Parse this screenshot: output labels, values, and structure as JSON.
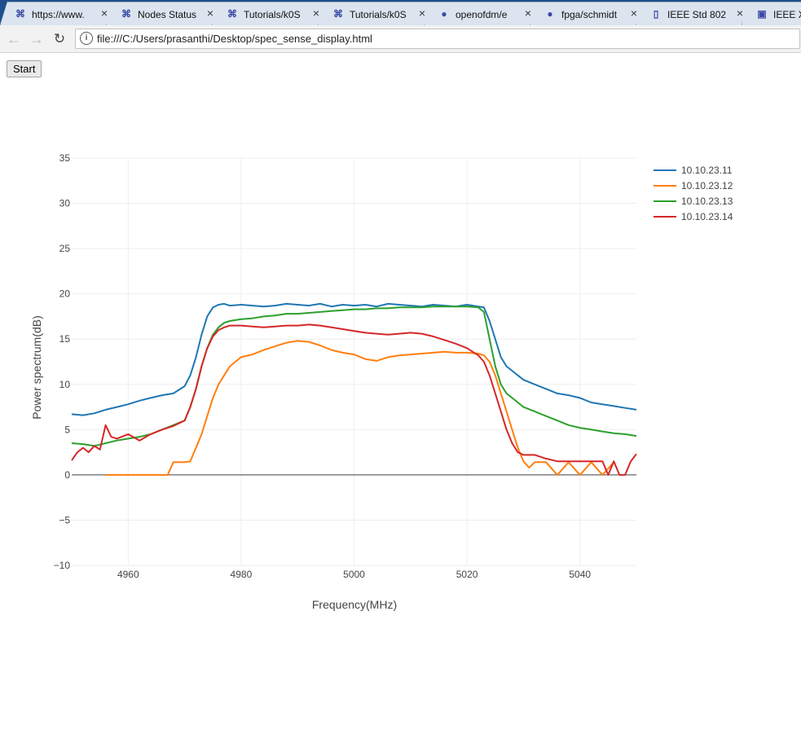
{
  "browser": {
    "tabs": [
      {
        "label": "https://www.",
        "icon": "orbit-icon"
      },
      {
        "label": "Nodes Status",
        "icon": "orbit-icon"
      },
      {
        "label": "Tutorials/k0S",
        "icon": "orbit-icon"
      },
      {
        "label": "Tutorials/k0S",
        "icon": "orbit-icon"
      },
      {
        "label": "openofdm/e",
        "icon": "github-icon"
      },
      {
        "label": "fpga/schmidt",
        "icon": "github-icon"
      },
      {
        "label": "IEEE Std 802",
        "icon": "document-icon"
      },
      {
        "label": "IEEE X",
        "icon": "ieee-icon"
      }
    ],
    "url": "file:///C:/Users/prasanthi/Desktop/spec_sense_display.html"
  },
  "page": {
    "start_label": "Start"
  },
  "chart_data": {
    "type": "line",
    "title": "",
    "xlabel": "Frequency(MHz)",
    "ylabel": "Power spectrum(dB)",
    "xlim": [
      4950,
      5050
    ],
    "ylim": [
      -10,
      35
    ],
    "xticks": [
      4960,
      4980,
      5000,
      5020,
      5040
    ],
    "yticks": [
      -10,
      -5,
      0,
      5,
      10,
      15,
      20,
      25,
      30,
      35
    ],
    "grid": true,
    "legend_position": "top-right, outside plot",
    "series": [
      {
        "name": "10.10.23.11",
        "color": "#1f77b4",
        "x": [
          4950,
          4952,
          4954,
          4956,
          4958,
          4960,
          4962,
          4964,
          4966,
          4968,
          4970,
          4971,
          4972,
          4973,
          4974,
          4975,
          4976,
          4977,
          4978,
          4980,
          4982,
          4984,
          4986,
          4988,
          4990,
          4992,
          4994,
          4996,
          4998,
          5000,
          5002,
          5004,
          5006,
          5008,
          5010,
          5012,
          5014,
          5016,
          5018,
          5020,
          5022,
          5023,
          5024,
          5025,
          5026,
          5027,
          5028,
          5029,
          5030,
          5032,
          5034,
          5036,
          5038,
          5040,
          5042,
          5044,
          5046,
          5048,
          5050
        ],
        "y": [
          6.7,
          6.6,
          6.8,
          7.2,
          7.5,
          7.8,
          8.2,
          8.5,
          8.8,
          9.0,
          9.8,
          11.0,
          13.0,
          15.5,
          17.5,
          18.5,
          18.8,
          18.9,
          18.7,
          18.8,
          18.7,
          18.6,
          18.7,
          18.9,
          18.8,
          18.7,
          18.9,
          18.6,
          18.8,
          18.7,
          18.8,
          18.6,
          18.9,
          18.8,
          18.7,
          18.6,
          18.8,
          18.7,
          18.6,
          18.8,
          18.6,
          18.5,
          17.0,
          15.0,
          13.0,
          12.0,
          11.5,
          11.0,
          10.5,
          10.0,
          9.5,
          9.0,
          8.8,
          8.5,
          8.0,
          7.8,
          7.6,
          7.4,
          7.2
        ]
      },
      {
        "name": "10.10.23.12",
        "color": "#ff7f0e",
        "x": [
          4956,
          4958,
          4960,
          4962,
          4964,
          4966,
          4967,
          4968,
          4969,
          4970,
          4971,
          4972,
          4973,
          4974,
          4975,
          4976,
          4977,
          4978,
          4980,
          4982,
          4984,
          4986,
          4988,
          4990,
          4992,
          4994,
          4996,
          4998,
          5000,
          5002,
          5004,
          5006,
          5008,
          5010,
          5012,
          5014,
          5016,
          5018,
          5020,
          5022,
          5023,
          5024,
          5025,
          5026,
          5027,
          5028,
          5029,
          5030,
          5031,
          5032,
          5034,
          5036,
          5038,
          5040,
          5042,
          5044,
          5046
        ],
        "y": [
          0.0,
          0.0,
          0.0,
          0.0,
          0.0,
          0.0,
          0.0,
          1.4,
          1.4,
          1.4,
          1.5,
          3.0,
          4.5,
          6.5,
          8.5,
          10.0,
          11.0,
          12.0,
          13.0,
          13.3,
          13.8,
          14.2,
          14.6,
          14.8,
          14.7,
          14.3,
          13.8,
          13.5,
          13.3,
          12.8,
          12.6,
          13.0,
          13.2,
          13.3,
          13.4,
          13.5,
          13.6,
          13.5,
          13.5,
          13.4,
          13.2,
          12.5,
          11.0,
          9.0,
          7.0,
          5.0,
          3.0,
          1.5,
          0.8,
          1.4,
          1.4,
          0.0,
          1.4,
          0.0,
          1.4,
          0.0,
          1.4
        ]
      },
      {
        "name": "10.10.23.13",
        "color": "#2ca02c",
        "x": [
          4950,
          4952,
          4954,
          4956,
          4958,
          4960,
          4962,
          4964,
          4966,
          4968,
          4970,
          4971,
          4972,
          4973,
          4974,
          4975,
          4976,
          4977,
          4978,
          4980,
          4982,
          4984,
          4986,
          4988,
          4990,
          4992,
          4994,
          4996,
          4998,
          5000,
          5002,
          5004,
          5006,
          5008,
          5010,
          5012,
          5014,
          5016,
          5018,
          5020,
          5022,
          5023,
          5024,
          5025,
          5026,
          5027,
          5028,
          5029,
          5030,
          5032,
          5034,
          5036,
          5038,
          5040,
          5042,
          5044,
          5046,
          5048,
          5050
        ],
        "y": [
          3.5,
          3.4,
          3.2,
          3.5,
          3.8,
          4.0,
          4.2,
          4.5,
          5.0,
          5.5,
          6.0,
          7.5,
          9.5,
          12.0,
          14.0,
          15.5,
          16.3,
          16.8,
          17.0,
          17.2,
          17.3,
          17.5,
          17.6,
          17.8,
          17.8,
          17.9,
          18.0,
          18.1,
          18.2,
          18.3,
          18.3,
          18.4,
          18.4,
          18.5,
          18.5,
          18.5,
          18.6,
          18.6,
          18.6,
          18.6,
          18.5,
          18.0,
          15.0,
          12.0,
          10.0,
          9.0,
          8.5,
          8.0,
          7.5,
          7.0,
          6.5,
          6.0,
          5.5,
          5.2,
          5.0,
          4.8,
          4.6,
          4.5,
          4.3
        ]
      },
      {
        "name": "10.10.23.14",
        "color": "#d62728",
        "x": [
          4950,
          4951,
          4952,
          4953,
          4954,
          4955,
          4956,
          4957,
          4958,
          4960,
          4962,
          4964,
          4966,
          4968,
          4970,
          4971,
          4972,
          4973,
          4974,
          4975,
          4976,
          4977,
          4978,
          4980,
          4982,
          4984,
          4986,
          4988,
          4990,
          4992,
          4994,
          4996,
          4998,
          5000,
          5002,
          5004,
          5006,
          5008,
          5010,
          5012,
          5014,
          5016,
          5018,
          5020,
          5022,
          5023,
          5024,
          5025,
          5026,
          5027,
          5028,
          5029,
          5030,
          5032,
          5034,
          5036,
          5038,
          5040,
          5042,
          5044,
          5045,
          5046,
          5047,
          5048,
          5049,
          5050
        ],
        "y": [
          1.6,
          2.5,
          3.0,
          2.5,
          3.2,
          2.8,
          5.5,
          4.2,
          4.0,
          4.5,
          3.8,
          4.5,
          5.0,
          5.4,
          6.0,
          7.5,
          9.5,
          12.0,
          14.0,
          15.3,
          16.0,
          16.3,
          16.5,
          16.5,
          16.4,
          16.3,
          16.4,
          16.5,
          16.5,
          16.6,
          16.5,
          16.3,
          16.1,
          15.9,
          15.7,
          15.6,
          15.5,
          15.6,
          15.7,
          15.6,
          15.3,
          14.9,
          14.5,
          14.0,
          13.2,
          12.5,
          11.0,
          9.0,
          7.0,
          5.0,
          3.5,
          2.5,
          2.2,
          2.2,
          1.8,
          1.5,
          1.5,
          1.5,
          1.5,
          1.5,
          0.0,
          1.5,
          0.0,
          0.0,
          1.5,
          2.3
        ]
      }
    ]
  }
}
